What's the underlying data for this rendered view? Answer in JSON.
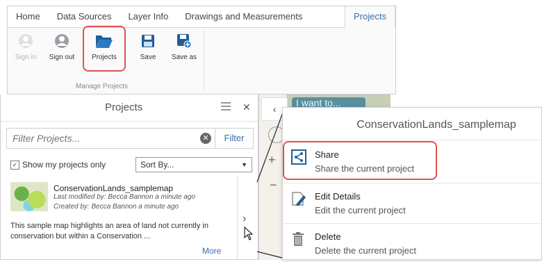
{
  "ribbon": {
    "tabs": [
      "Home",
      "Data Sources",
      "Layer Info",
      "Drawings and Measurements",
      "Projects"
    ],
    "active_tab": "Projects",
    "buttons": {
      "sign_in": "Sign in",
      "sign_out": "Sign out",
      "projects": "Projects",
      "save": "Save",
      "save_as": "Save as"
    },
    "group_label": "Manage Projects"
  },
  "panel": {
    "title": "Projects",
    "search_placeholder": "Filter Projects...",
    "filter_label": "Filter",
    "clear_symbol": "✕",
    "checkbox_label": "Show my projects only",
    "sort_label": "Sort By...",
    "item": {
      "title": "ConservationLands_samplemap",
      "modified": "Last modified by: Becca Bannon a minute ago",
      "created": "Created by: Becca Bannon a minute ago",
      "description": "This sample map highlights an area of land not currently in conservation but within a Conservation ...",
      "more": "More"
    }
  },
  "map": {
    "button_text": "I want to..."
  },
  "context_menu": {
    "title": "ConservationLands_samplemap",
    "items": [
      {
        "title": "Share",
        "desc": "Share the current project"
      },
      {
        "title": "Edit Details",
        "desc": "Edit the current project"
      },
      {
        "title": "Delete",
        "desc": "Delete the current project"
      }
    ]
  },
  "colors": {
    "accent": "#3a6ea5",
    "highlight": "#e05050"
  }
}
